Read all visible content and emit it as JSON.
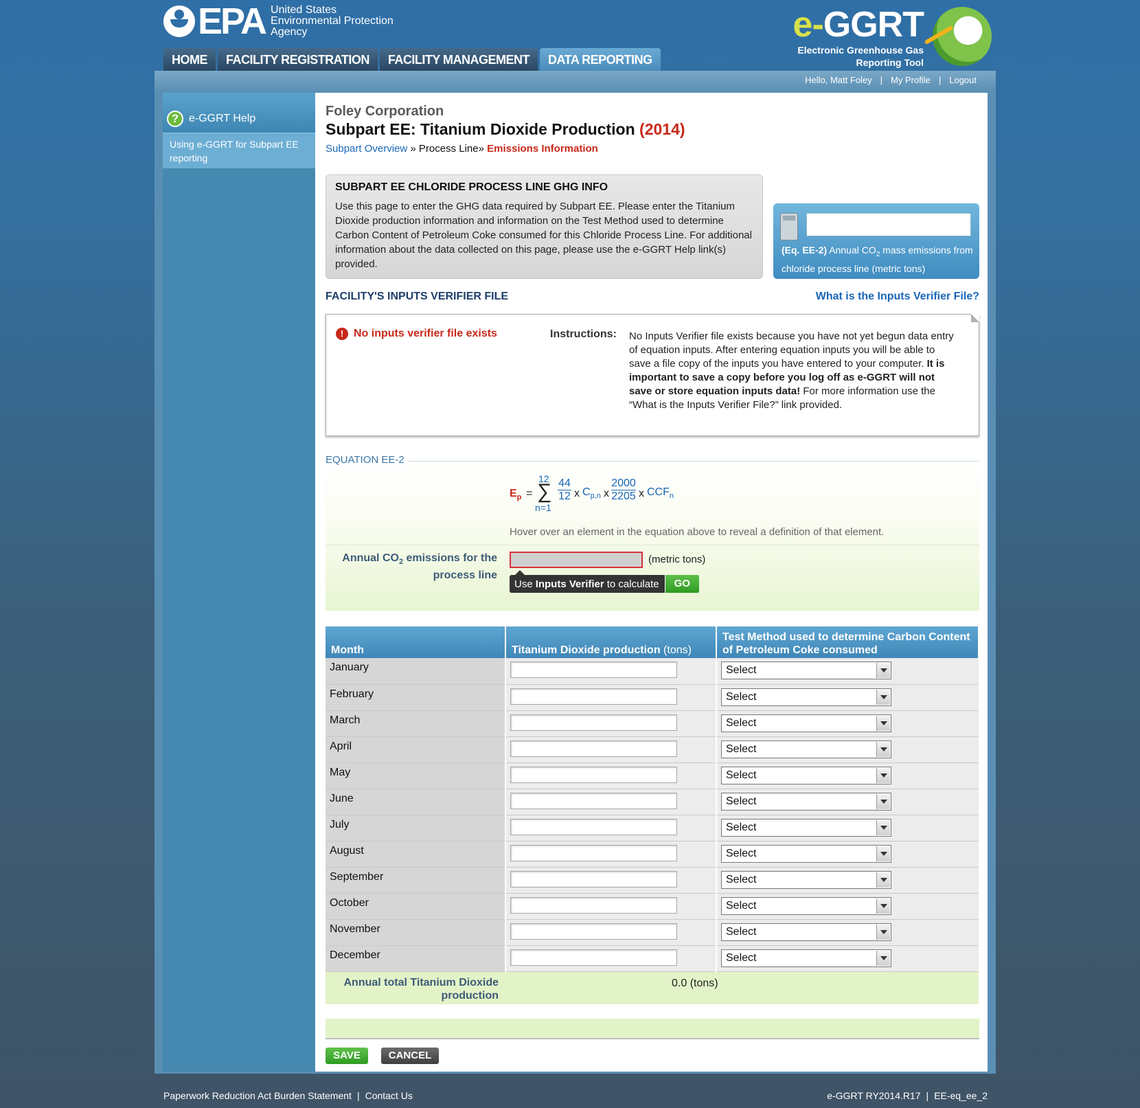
{
  "header": {
    "epa_word": "EPA",
    "epa_agency_lines": [
      "United States",
      "Environmental Protection",
      "Agency"
    ],
    "app_title_e": "e-",
    "app_title_rest": "GGRT",
    "app_subtitle_lines": [
      "Electronic Greenhouse Gas",
      "Reporting Tool"
    ]
  },
  "nav": {
    "tabs": [
      {
        "label": "HOME"
      },
      {
        "label": "FACILITY REGISTRATION"
      },
      {
        "label": "FACILITY MANAGEMENT"
      },
      {
        "label": "DATA REPORTING",
        "active": true
      }
    ]
  },
  "userbar": {
    "greeting": "Hello, Matt Foley",
    "separator": "|",
    "profile": "My Profile",
    "logout": "Logout"
  },
  "sidebar": {
    "help_title": "e-GGRT Help",
    "help_link": "Using e-GGRT for Subpart EE reporting"
  },
  "page": {
    "company": "Foley Corporation",
    "title": "Subpart EE: Titanium Dioxide Production",
    "year": "(2014)",
    "breadcrumb": {
      "overview": "Subpart Overview",
      "sep": "»",
      "process_line": "Process Line",
      "current": "Emissions Information"
    }
  },
  "info_box": {
    "heading": "SUBPART EE CHLORIDE PROCESS LINE GHG INFO",
    "text": "Use this page to enter the GHG data required by Subpart EE. Please enter the Titanium Dioxide production information and information on the Test Method used to determine Carbon Content of Petroleum Coke consumed for this Chloride Process Line. For additional information about the data collected on this page, please use the e-GGRT Help link(s) provided."
  },
  "calc_box": {
    "value": "",
    "eq_label": "(Eq. EE-2)",
    "description_pre": "Annual CO",
    "description_sub": "2",
    "description_post": " mass emissions from chloride process line (metric tons)"
  },
  "verifier": {
    "heading": "FACILITY'S INPUTS VERIFIER FILE",
    "help_link": "What is the Inputs Verifier File?",
    "status": "No inputs verifier file exists",
    "instructions_label": "Instructions:",
    "instructions_text_1": "No Inputs Verifier file exists because you have not yet begun data entry of equation inputs.  After entering equation inputs you will be able to save a file copy of the inputs you have entered to your computer.  ",
    "instructions_bold": "It is important to save a copy before you log off as e-GGRT will not save or store equation inputs data!",
    "instructions_text_2": " For more information use the “What is the Inputs Verifier File?” link provided."
  },
  "equation": {
    "heading": "EQUATION EE-2",
    "lhs": "E",
    "lhs_sub": "p",
    "equals": "=",
    "sum_top": "12",
    "sum_symbol": "∑",
    "sum_bottom": "n=1",
    "frac1_num": "44",
    "frac1_den": "12",
    "times": "x",
    "cp": "C",
    "cp_sub": "p,n",
    "frac2_num": "2000",
    "frac2_den": "2205",
    "ccf": "CCF",
    "ccf_sub": "n",
    "hover_note": "Hover over an element in the equation above to reveal a definition of that element.",
    "annual_label_pre": "Annual CO",
    "annual_label_sub": "2",
    "annual_label_post": " emissions for the process line",
    "annual_value": "",
    "units": "(metric tons)",
    "verifier_btn_pre": "Use ",
    "verifier_btn_bold": "Inputs Verifier",
    "verifier_btn_post": " to calculate",
    "go": "GO"
  },
  "table": {
    "col_month": "Month",
    "col_production": "Titanium Dioxide production",
    "col_production_units": "(tons)",
    "col_method": "Test Method used to determine Carbon Content of Petroleum Coke consumed",
    "select_default": "Select",
    "rows": [
      {
        "month": "January",
        "production": ""
      },
      {
        "month": "February",
        "production": ""
      },
      {
        "month": "March",
        "production": ""
      },
      {
        "month": "April",
        "production": ""
      },
      {
        "month": "May",
        "production": ""
      },
      {
        "month": "June",
        "production": ""
      },
      {
        "month": "July",
        "production": ""
      },
      {
        "month": "August",
        "production": ""
      },
      {
        "month": "September",
        "production": ""
      },
      {
        "month": "October",
        "production": ""
      },
      {
        "month": "November",
        "production": ""
      },
      {
        "month": "December",
        "production": ""
      }
    ],
    "total_label": "Annual total Titanium Dioxide production",
    "total_value": "0.0 (tons)"
  },
  "buttons": {
    "save": "SAVE",
    "cancel": "CANCEL"
  },
  "footer": {
    "paperwork": "Paperwork Reduction Act Burden Statement",
    "contact": "Contact Us",
    "version": "e-GGRT RY2014.R17",
    "page_id": "EE-eq_ee_2",
    "separator": "|"
  }
}
